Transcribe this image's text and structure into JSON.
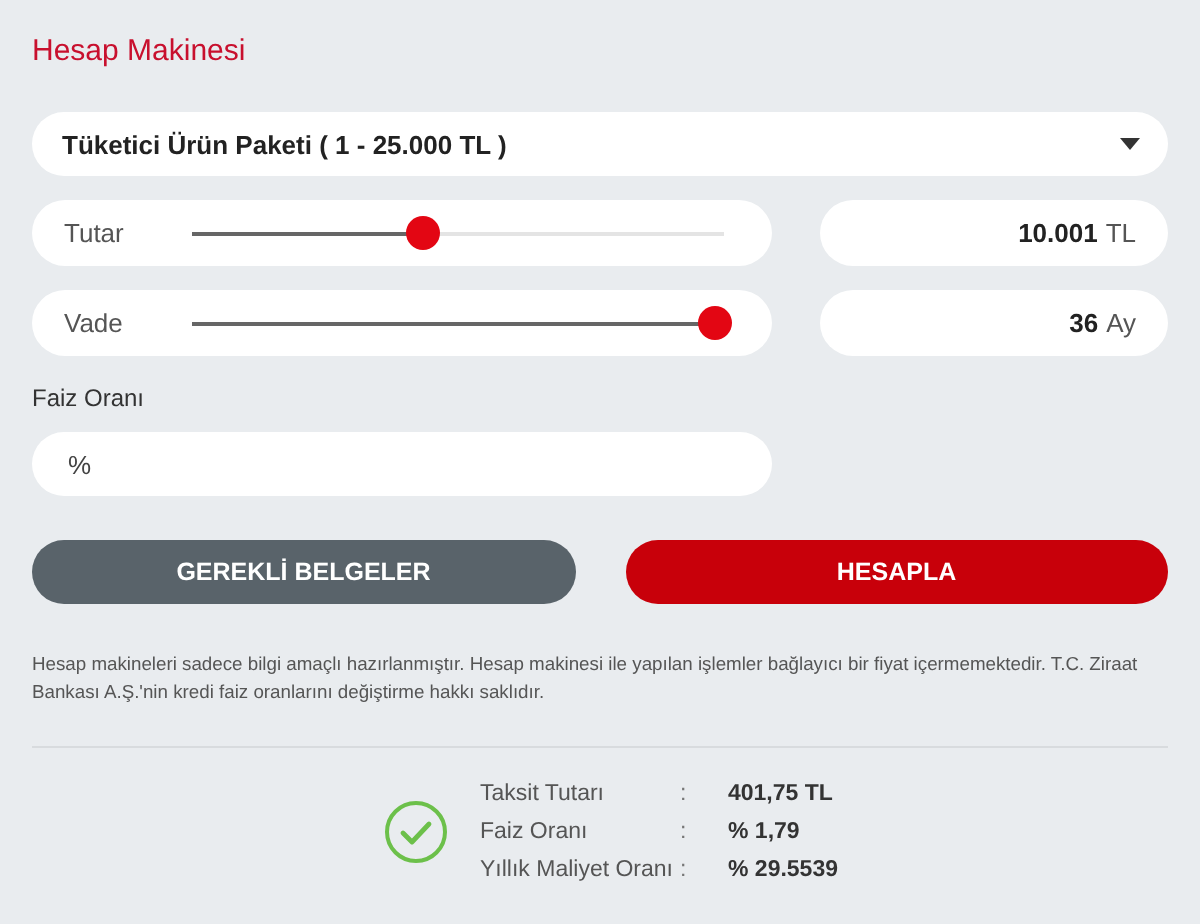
{
  "title": "Hesap Makinesi",
  "product_select": {
    "value": "Tüketici Ürün Paketi ( 1 - 25.000 TL )"
  },
  "sliders": [
    {
      "label": "Tutar",
      "level": 0.43,
      "value": "10.001",
      "unit": "TL"
    },
    {
      "label": "Vade",
      "level": 1,
      "value": "36",
      "unit": "Ay"
    }
  ],
  "rate_field": {
    "label": "Faiz Oranı",
    "placeholder": "%"
  },
  "buttons": [
    {
      "label": "GEREKLİ BELGELER",
      "kind": "secondary"
    },
    {
      "label": "HESAPLA",
      "kind": "primary"
    }
  ],
  "disclaimer": "Hesap makineleri sadece bilgi amaçlı hazırlanmıştır. Hesap makinesi ile yapılan işlemler bağlayıcı bir fiyat içermemektedir. T.C. Ziraat Bankası A.Ş.'nin kredi faiz oranlarını değiştirme hakkı saklıdır.",
  "results": [
    {
      "label": "Taksit Tutarı",
      "separator": ":",
      "value": "401,75 TL"
    },
    {
      "label": "Faiz Oranı",
      "separator": ":",
      "value": "% 1,79"
    },
    {
      "label": "Yıllık Maliyet Oranı",
      "separator": ":",
      "value": "% 29.5539"
    }
  ]
}
